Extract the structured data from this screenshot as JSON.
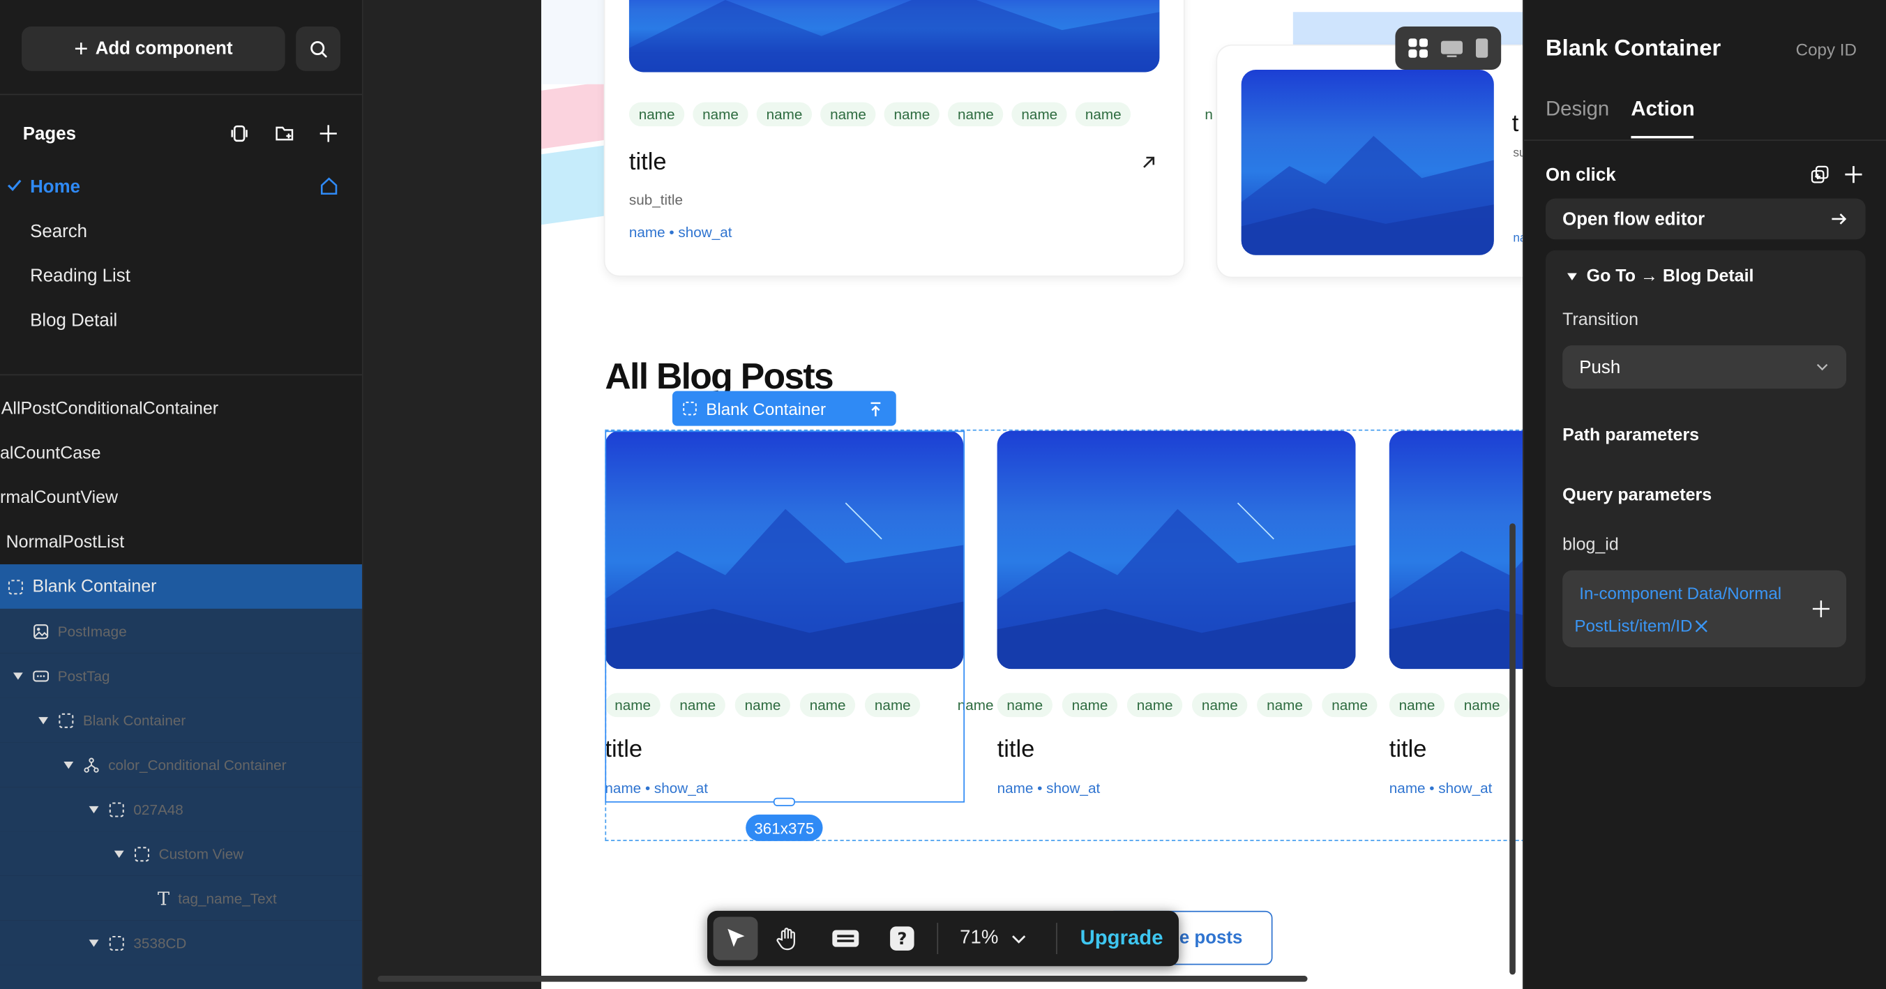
{
  "left_panel": {
    "add_component_label": "Add component",
    "pages_title": "Pages",
    "pages": [
      {
        "label": "Home",
        "active": true
      },
      {
        "label": "Search"
      },
      {
        "label": "Reading List"
      },
      {
        "label": "Blog Detail"
      }
    ],
    "layers": [
      {
        "label": "AllPostConditionalContainer"
      },
      {
        "label": "alCountCase"
      },
      {
        "label": "rmalCountView"
      },
      {
        "label": "NormalPostList"
      },
      {
        "label": "Blank Container"
      },
      {
        "label": "PostImage"
      },
      {
        "label": "PostTag"
      },
      {
        "label": "Blank Container"
      },
      {
        "label": "color_Conditional Container"
      },
      {
        "label": "027A48"
      },
      {
        "label": "Custom View"
      },
      {
        "label": "tag_name_Text"
      },
      {
        "label": "3538CD"
      }
    ]
  },
  "canvas": {
    "tag_label": "name",
    "card_title": "title",
    "card_subtitle": "sub_title",
    "card_meta": "name • show_at",
    "card_title_short": "t",
    "card_sub_short": "su",
    "card_meta_short": "na",
    "section_heading": "All Blog Posts",
    "selection_label": "Blank Container",
    "size_badge": "361x375",
    "more_button_label": "e posts",
    "partial_tag": "n",
    "partial_tag2": "name"
  },
  "toolbar": {
    "zoom": "71%",
    "upgrade_label": "Upgrade"
  },
  "right_panel": {
    "title": "Blank Container",
    "copy_id": "Copy ID",
    "tabs": [
      {
        "label": "Design"
      },
      {
        "label": "Action",
        "active": true
      }
    ],
    "on_click": "On click",
    "open_flow": "Open flow editor",
    "goto_label": "Go To → Blog Detail",
    "transition_label": "Transition",
    "transition_value": "Push",
    "path_params": "Path parameters",
    "query_params": "Query parameters",
    "param_name": "blog_id",
    "param_value_1": "In-component Data/Normal",
    "param_value_2": "PostList/item/ID"
  },
  "colors": {
    "accent": "#2f8af5",
    "selection": "#1e5aa0",
    "upgrade": "#3ec6f0"
  }
}
